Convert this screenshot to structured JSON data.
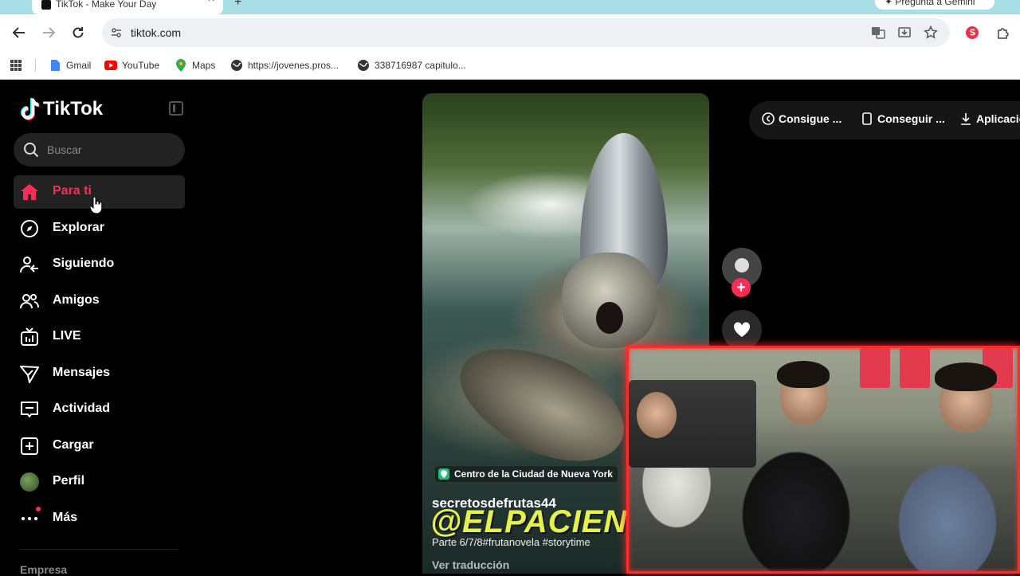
{
  "browser": {
    "tab_title": "TikTok - Make Your Day",
    "gemini_label": "Pregunta a Gemini",
    "url": "tiktok.com",
    "bookmarks": [
      {
        "label": "Gmail",
        "icon": "gmail-icon"
      },
      {
        "label": "YouTube",
        "icon": "youtube-icon"
      },
      {
        "label": "Maps",
        "icon": "maps-icon"
      },
      {
        "label": "https://jovenes.pros...",
        "icon": "globe-icon"
      },
      {
        "label": "338716987 capitulo...",
        "icon": "globe-icon"
      }
    ]
  },
  "sidebar": {
    "brand": "TikTok",
    "search_placeholder": "Buscar",
    "items": [
      {
        "label": "Para ti",
        "icon": "home-icon",
        "active": true
      },
      {
        "label": "Explorar",
        "icon": "compass-icon"
      },
      {
        "label": "Siguiendo",
        "icon": "user-following-icon"
      },
      {
        "label": "Amigos",
        "icon": "friends-icon"
      },
      {
        "label": "LIVE",
        "icon": "live-tv-icon"
      },
      {
        "label": "Mensajes",
        "icon": "send-icon"
      },
      {
        "label": "Actividad",
        "icon": "activity-icon"
      },
      {
        "label": "Cargar",
        "icon": "upload-plus-icon"
      },
      {
        "label": "Perfil",
        "icon": "avatar"
      },
      {
        "label": "Más",
        "icon": "more-dots-icon"
      }
    ],
    "footer_heading": "Empresa"
  },
  "video": {
    "location": "Centro de la Ciudad de Nueva York",
    "username": "secretosdefrutas44",
    "overlay_text": "@ELPACIENTE",
    "caption": "Parte 6/7/8#frutanovela #storytime",
    "translate_label": "Ver traducción"
  },
  "top_actions": {
    "coins_label": "Consigue ...",
    "app_label": "Conseguir ...",
    "download_label": "Aplicación"
  },
  "colors": {
    "accent": "#fe2c55",
    "background": "#000000",
    "sidebar_active_bg": "#222222",
    "webcam_border": "#ff2b2b"
  }
}
